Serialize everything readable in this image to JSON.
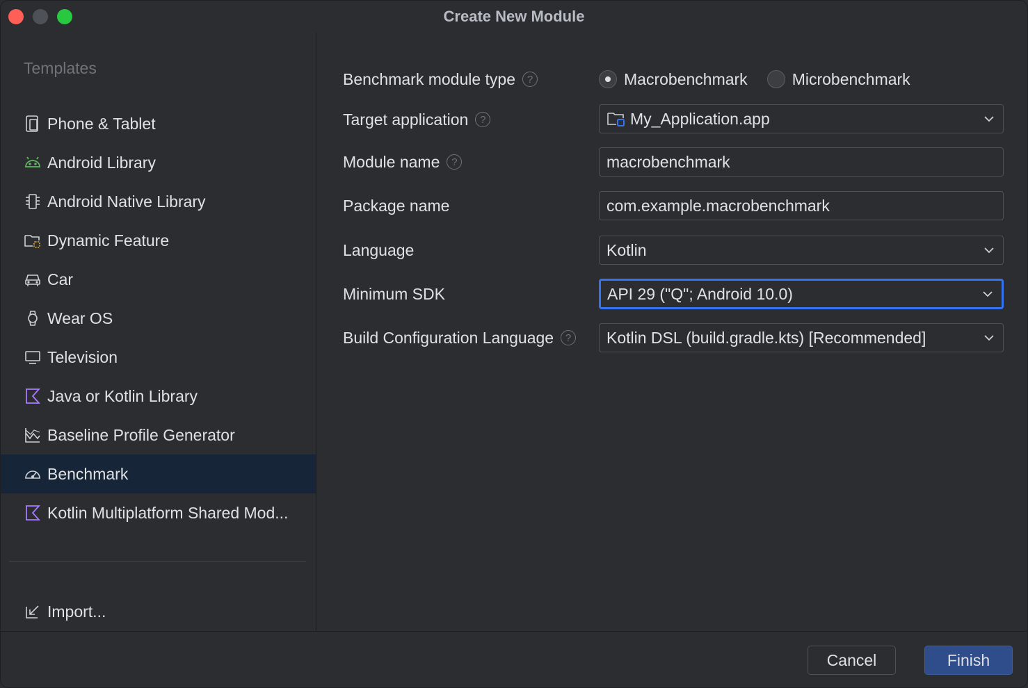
{
  "window": {
    "title": "Create New Module"
  },
  "sidebar": {
    "header": "Templates",
    "items": [
      {
        "label": "Phone & Tablet",
        "icon": "phone-tablet-icon"
      },
      {
        "label": "Android Library",
        "icon": "android-icon"
      },
      {
        "label": "Android Native Library",
        "icon": "chip-icon"
      },
      {
        "label": "Dynamic Feature",
        "icon": "dynamic-folder-icon"
      },
      {
        "label": "Car",
        "icon": "car-icon"
      },
      {
        "label": "Wear OS",
        "icon": "watch-icon"
      },
      {
        "label": "Television",
        "icon": "tv-icon"
      },
      {
        "label": "Java or Kotlin Library",
        "icon": "kotlin-icon"
      },
      {
        "label": "Baseline Profile Generator",
        "icon": "chart-icon"
      },
      {
        "label": "Benchmark",
        "icon": "gauge-icon",
        "selected": true
      },
      {
        "label": "Kotlin Multiplatform Shared Mod...",
        "icon": "kotlin-icon"
      }
    ],
    "import_label": "Import..."
  },
  "form": {
    "benchmark_type": {
      "label": "Benchmark module type",
      "options": [
        "Macrobenchmark",
        "Microbenchmark"
      ],
      "selected": "Macrobenchmark"
    },
    "target_application": {
      "label": "Target application",
      "value": "My_Application.app"
    },
    "module_name": {
      "label": "Module name",
      "value": "macrobenchmark"
    },
    "package_name": {
      "label": "Package name",
      "value": "com.example.macrobenchmark"
    },
    "language": {
      "label": "Language",
      "value": "Kotlin"
    },
    "minimum_sdk": {
      "label": "Minimum SDK",
      "value": "API 29 (\"Q\"; Android 10.0)"
    },
    "build_config_language": {
      "label": "Build Configuration Language",
      "value": "Kotlin DSL (build.gradle.kts) [Recommended]"
    }
  },
  "footer": {
    "cancel_label": "Cancel",
    "finish_label": "Finish"
  },
  "colors": {
    "accent": "#3574f0",
    "selected_bg": "#162638",
    "android_green": "#5fb85f",
    "kotlin_purple": "#a97bff"
  }
}
